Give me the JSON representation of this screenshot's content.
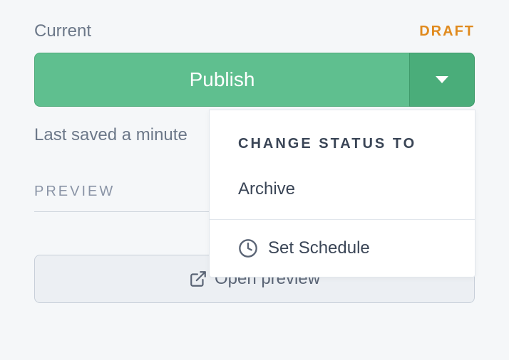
{
  "status": {
    "currentLabel": "Current",
    "badge": "DRAFT"
  },
  "publish": {
    "buttonLabel": "Publish"
  },
  "lastSaved": "Last saved a minute",
  "preview": {
    "sectionLabel": "PREVIEW",
    "openLabel": "Open preview"
  },
  "dropdown": {
    "header": "CHANGE STATUS TO",
    "archiveLabel": "Archive",
    "scheduleLabel": "Set Schedule"
  }
}
